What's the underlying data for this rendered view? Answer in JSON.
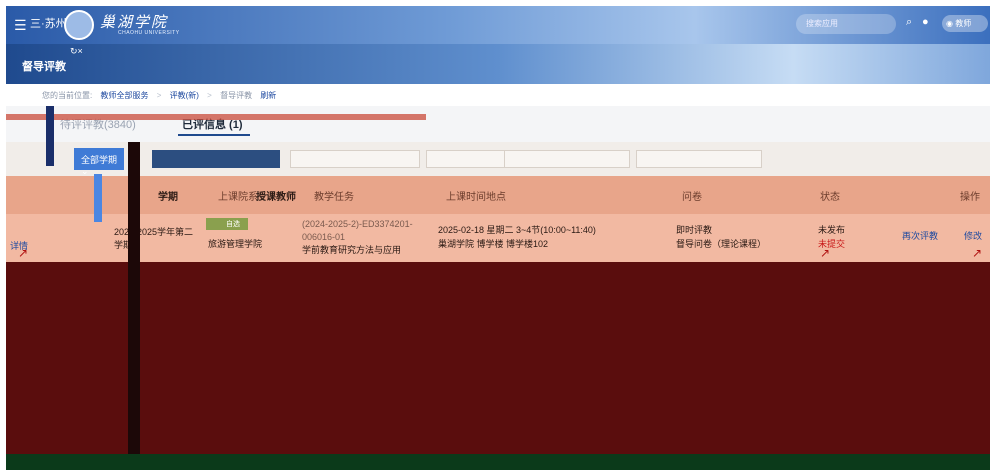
{
  "header": {
    "brand_prefix": "三·苏州",
    "school_name": "巢湖学院",
    "school_en": "CHAOHU UNIVERSITY",
    "search_placeholder": "搜索应用",
    "user_label": "教师"
  },
  "module": {
    "title": "督导评教"
  },
  "breadcrumb": {
    "prefix": "您的当前位置:",
    "items": [
      "教师全部服务",
      "评教(新)",
      "督导评教",
      "刷新"
    ]
  },
  "tabs": {
    "pending": "待评评教(3840)",
    "done": "已评信息 (1)"
  },
  "filters": {
    "term_button": "全部学期"
  },
  "table": {
    "headers": {
      "term": "学期",
      "college": "上课院系",
      "teacher": "授课教师",
      "task": "教学任务",
      "time_place": "上课时间地点",
      "questionnaire": "问卷",
      "status": "状态",
      "action": "操作"
    },
    "row": {
      "detail": "详情",
      "term": "2024-2025学年第二学期",
      "tag": "自选",
      "college": "旅游管理学院",
      "task_code": "(2024-2025-2)-ED3374201-006016-01",
      "task_name": "学前教育研究方法与应用",
      "time": "2025-02-18 星期二 3~4节(10:00~11:40)",
      "place": "巢湖学院 博学楼 博学楼102",
      "eval_type": "即时评教",
      "questionnaire": "督导问卷（理论课程）",
      "status_1": "未发布",
      "status_2": "未提交",
      "action_again": "再次评教",
      "action_edit": "修改"
    }
  }
}
